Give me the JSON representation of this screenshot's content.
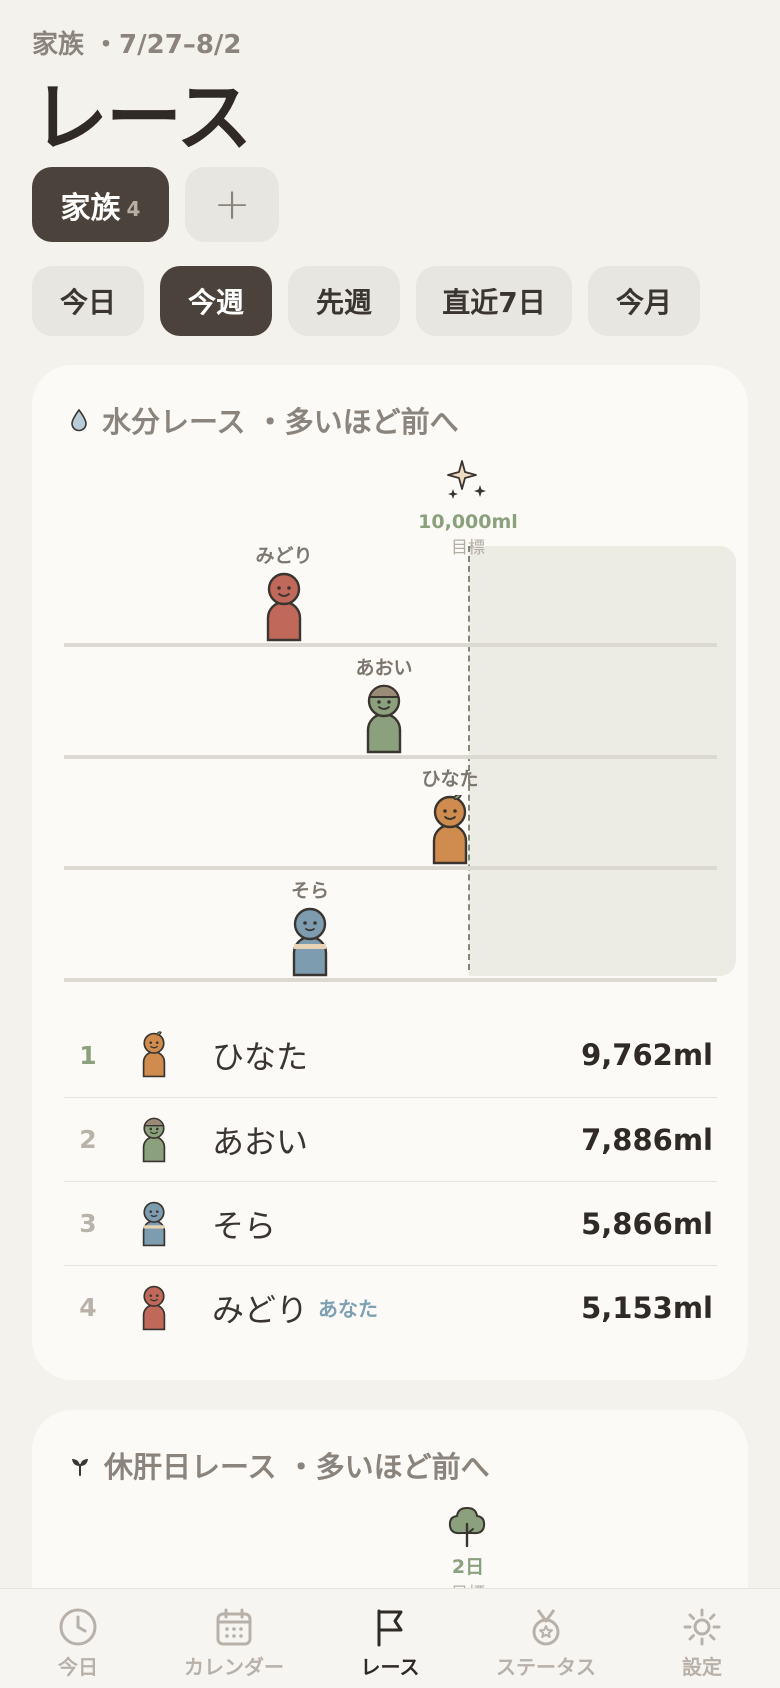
{
  "header": {
    "subtitle": "家族 ・7/27–8/2",
    "title": "レース"
  },
  "groups": {
    "active_label": "家族",
    "active_count": "4",
    "add_label": "+"
  },
  "periods": [
    {
      "label": "今日",
      "active": false
    },
    {
      "label": "今週",
      "active": true
    },
    {
      "label": "先週",
      "active": false
    },
    {
      "label": "直近7日",
      "active": false
    },
    {
      "label": "今月",
      "active": false
    }
  ],
  "water_race": {
    "title": "水分レース ・多いほど前へ",
    "icon": "water-drop-icon",
    "goal_value": "10,000ml",
    "goal_sub": "目標",
    "goal_icon": "sparkle-icon",
    "runners": [
      {
        "name": "みどり",
        "progress": 0.5153,
        "color": "#c0685a"
      },
      {
        "name": "あおい",
        "progress": 0.7886,
        "color": "#8ba07c"
      },
      {
        "name": "ひなた",
        "progress": 0.9762,
        "color": "#d08c4e"
      },
      {
        "name": "そら",
        "progress": 0.5866,
        "color": "#7d9cb0"
      }
    ],
    "ranking": [
      {
        "rank": "1",
        "name": "ひなた",
        "you": "",
        "value": "9,762ml"
      },
      {
        "rank": "2",
        "name": "あおい",
        "you": "",
        "value": "7,886ml"
      },
      {
        "rank": "3",
        "name": "そら",
        "you": "",
        "value": "5,866ml"
      },
      {
        "rank": "4",
        "name": "みどり",
        "you": "あなた",
        "value": "5,153ml"
      }
    ]
  },
  "liver_race": {
    "title": "休肝日レース ・多いほど前へ",
    "icon": "sprout-icon",
    "goal_value": "2日",
    "goal_sub": "目標",
    "goal_icon": "tree-icon"
  },
  "tabbar": [
    {
      "label": "今日",
      "icon": "clock-icon",
      "active": false
    },
    {
      "label": "カレンダー",
      "icon": "calendar-icon",
      "active": false
    },
    {
      "label": "レース",
      "icon": "flag-icon",
      "active": true
    },
    {
      "label": "ステータス",
      "icon": "medal-icon",
      "active": false
    },
    {
      "label": "設定",
      "icon": "gear-icon",
      "active": false
    }
  ],
  "colors": {
    "background": "#f4f2ed",
    "dark_pill": "#4a423b",
    "goal_green": "#8ba07c",
    "you_blue": "#7da0b3"
  }
}
